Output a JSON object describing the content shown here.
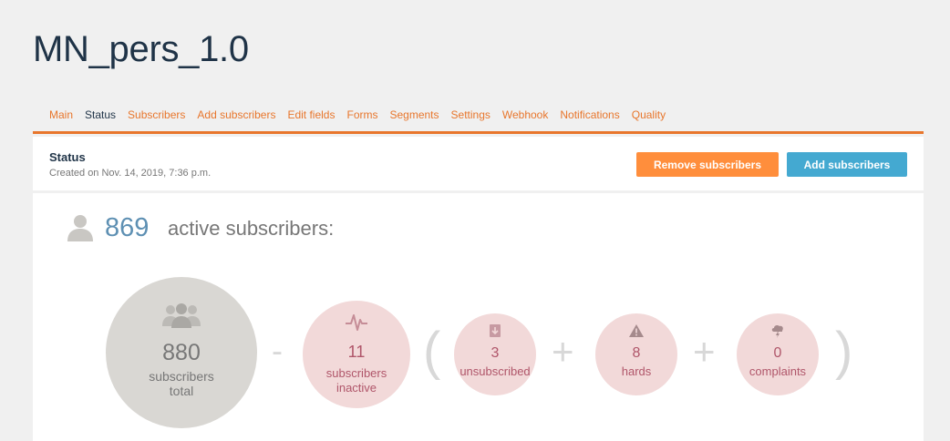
{
  "page": {
    "title": "MN_pers_1.0"
  },
  "tabs": [
    {
      "label": "Main",
      "active": false
    },
    {
      "label": "Status",
      "active": true
    },
    {
      "label": "Subscribers",
      "active": false
    },
    {
      "label": "Add subscribers",
      "active": false
    },
    {
      "label": "Edit fields",
      "active": false
    },
    {
      "label": "Forms",
      "active": false
    },
    {
      "label": "Segments",
      "active": false
    },
    {
      "label": "Settings",
      "active": false
    },
    {
      "label": "Webhook",
      "active": false
    },
    {
      "label": "Notifications",
      "active": false
    },
    {
      "label": "Quality",
      "active": false
    }
  ],
  "status": {
    "title": "Status",
    "created": "Created on Nov. 14, 2019, 7:36 p.m.",
    "remove_button": "Remove subscribers",
    "add_button": "Add subscribers"
  },
  "summary": {
    "active_count": "869",
    "active_label": "active subscribers:"
  },
  "stats": {
    "total": {
      "value": "880",
      "label_1": "subscribers",
      "label_2": "total",
      "icon": "users-icon"
    },
    "inactive": {
      "value": "11",
      "label_1": "subscribers",
      "label_2": "inactive",
      "icon": "pulse-icon"
    },
    "unsubscribed": {
      "value": "3",
      "label": "unsubscribed",
      "icon": "unsubscribe-icon"
    },
    "hards": {
      "value": "8",
      "label": "hards",
      "icon": "warning-icon"
    },
    "complaints": {
      "value": "0",
      "label": "complaints",
      "icon": "storm-cloud-icon"
    }
  },
  "operators": {
    "minus": "-",
    "open_paren": "(",
    "plus_1": "+",
    "plus_2": "+",
    "close_paren": ")"
  },
  "colors": {
    "accent_orange": "#e8762c",
    "remove_button": "#ff8e3c",
    "add_button": "#44a9d1",
    "title_dark": "#1f3347",
    "active_count": "#5e90b3",
    "pink_circle": "#f2d9d9",
    "grey_circle": "#d9d7d3"
  }
}
